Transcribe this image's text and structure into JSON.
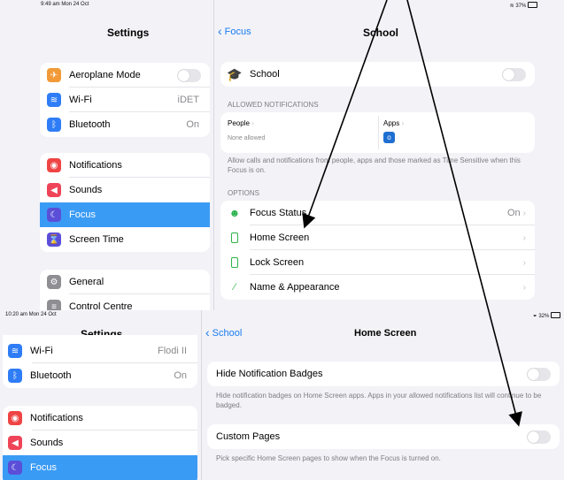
{
  "top": {
    "status_time": "9:49 am  Mon 24 Oct",
    "status_battery": "37%",
    "sidebar_title": "Settings",
    "settings_items": [
      {
        "label": "Aeroplane Mode",
        "icon": "airplane-icon",
        "color": "#f19a37",
        "glyph": "✈"
      },
      {
        "label": "Wi-Fi",
        "value": "iDET",
        "icon": "wifi-icon",
        "color": "#2f7df6",
        "glyph": "≋"
      },
      {
        "label": "Bluetooth",
        "value": "On",
        "icon": "bluetooth-icon",
        "color": "#2f7df6",
        "glyph": "ᛒ"
      },
      {
        "label": "Notifications",
        "icon": "bell-icon",
        "color": "#ef4444",
        "glyph": "◉"
      },
      {
        "label": "Sounds",
        "icon": "speaker-icon",
        "color": "#ef4458",
        "glyph": "◀"
      },
      {
        "label": "Focus",
        "icon": "moon-icon",
        "color": "#5b4fd8",
        "glyph": "☾"
      },
      {
        "label": "Screen Time",
        "icon": "hourglass-icon",
        "color": "#5b4fd8",
        "glyph": "⌛"
      },
      {
        "label": "General",
        "icon": "gear-icon",
        "color": "#8e8e93",
        "glyph": "⚙"
      },
      {
        "label": "Control Centre",
        "icon": "switches-icon",
        "color": "#8e8e93",
        "glyph": "≡"
      }
    ],
    "back_label": "Focus",
    "detail_title": "School",
    "school_label": "School",
    "allowed_header": "ALLOWED NOTIFICATIONS",
    "people_label": "People",
    "people_value": "None allowed",
    "apps_label": "Apps",
    "allowed_caption": "Allow calls and notifications from people, apps and those marked as Time Sensitive when this Focus is on.",
    "options_header": "OPTIONS",
    "options": [
      {
        "label": "Focus Status",
        "value": "On",
        "icon": "focus-status-icon"
      },
      {
        "label": "Home Screen",
        "icon": "phone-icon"
      },
      {
        "label": "Lock Screen",
        "icon": "phone-icon"
      },
      {
        "label": "Name & Appearance",
        "icon": "pencil-icon"
      }
    ]
  },
  "bottom": {
    "status_time": "10:20 am  Mon 24 Oct",
    "status_battery": "32%",
    "sidebar_title": "Settings",
    "settings_items": [
      {
        "label": "Wi-Fi",
        "value": "Flodi II",
        "icon": "wifi-icon",
        "color": "#2f7df6",
        "glyph": "≋"
      },
      {
        "label": "Bluetooth",
        "value": "On",
        "icon": "bluetooth-icon",
        "color": "#2f7df6",
        "glyph": "ᛒ"
      },
      {
        "label": "Notifications",
        "icon": "bell-icon",
        "color": "#ef4444",
        "glyph": "◉"
      },
      {
        "label": "Sounds",
        "icon": "speaker-icon",
        "color": "#ef4458",
        "glyph": "◀"
      },
      {
        "label": "Focus",
        "icon": "moon-icon",
        "color": "#5b4fd8",
        "glyph": "☾"
      }
    ],
    "back_label": "School",
    "detail_title": "Home Screen",
    "hide_badges_label": "Hide Notification Badges",
    "hide_badges_caption": "Hide notification badges on Home Screen apps. Apps in your allowed notifications list will continue to be badged.",
    "custom_pages_label": "Custom Pages",
    "custom_pages_caption": "Pick specific Home Screen pages to show when the Focus is turned on."
  },
  "colors": {
    "accent": "#1a7cf0",
    "selection": "#3a9bf5",
    "background": "#f2f2f7",
    "arrow": "#000000"
  }
}
